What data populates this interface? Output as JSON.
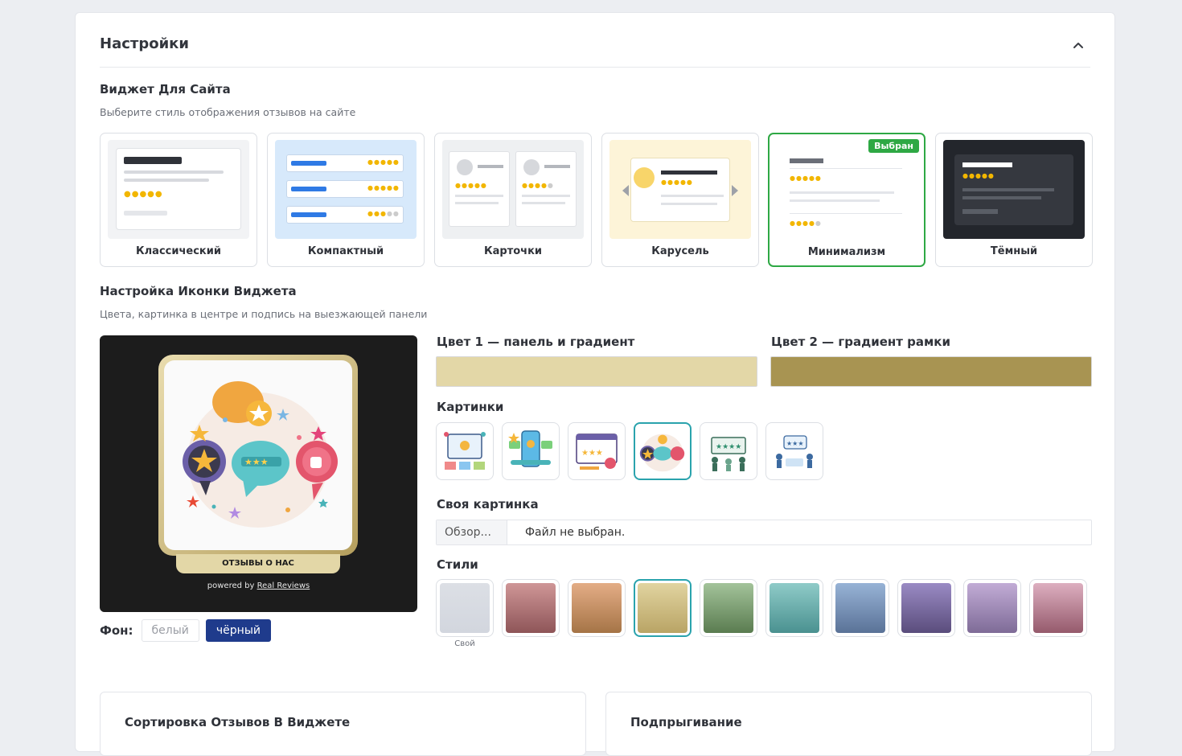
{
  "header": {
    "title": "Настройки"
  },
  "widget_section": {
    "title": "Виджет Для Сайта",
    "subtitle": "Выберите стиль отображения отзывов на сайте",
    "styles": [
      {
        "label": "Классический",
        "selected": false
      },
      {
        "label": "Компактный",
        "selected": false
      },
      {
        "label": "Карточки",
        "selected": false
      },
      {
        "label": "Карусель",
        "selected": false
      },
      {
        "label": "Минимализм",
        "selected": true
      },
      {
        "label": "Тёмный",
        "selected": false
      }
    ],
    "selected_badge": "Выбран"
  },
  "icon_section": {
    "title": "Настройка Иконки Виджета",
    "subtitle": "Цвета, картинка в центре и подпись на выезжающей панели",
    "preview": {
      "plate_text": "ОТЗЫВЫ О НАС",
      "powered_prefix": "powered by ",
      "powered_link": "Real Reviews"
    },
    "background": {
      "label": "Фон:",
      "options": [
        "белый",
        "чёрный"
      ],
      "selected": "чёрный"
    },
    "color1": {
      "label": "Цвет 1 — панель и градиент",
      "value": "#e3d7a7"
    },
    "color2": {
      "label": "Цвет 2 — градиент рамки",
      "value": "#a89452"
    },
    "pictures": {
      "label": "Картинки",
      "count": 6,
      "selected_index": 3
    },
    "custom_picture": {
      "label": "Своя картинка",
      "button": "Обзор...",
      "status": "Файл не выбран."
    },
    "styles": {
      "label": "Стили",
      "custom_caption": "Свой",
      "selected_index": 3,
      "swatches": [
        [
          "#dcdfe5",
          "#d2d6de"
        ],
        [
          "#cf9697",
          "#8e5558"
        ],
        [
          "#e4ad86",
          "#a57446"
        ],
        [
          "#e1d4a0",
          "#b9a465"
        ],
        [
          "#a3c39a",
          "#5a7c50"
        ],
        [
          "#8fcbc8",
          "#4a9190"
        ],
        [
          "#97b3d6",
          "#5a7297"
        ],
        [
          "#9a8bc4",
          "#5a4d7c"
        ],
        [
          "#c2acd6",
          "#7e6b97"
        ],
        [
          "#ddafc0",
          "#955a6c"
        ]
      ]
    }
  },
  "bottom_cards": [
    {
      "title": "Сортировка Отзывов В Виджете"
    },
    {
      "title": "Подпрыгивание"
    }
  ]
}
